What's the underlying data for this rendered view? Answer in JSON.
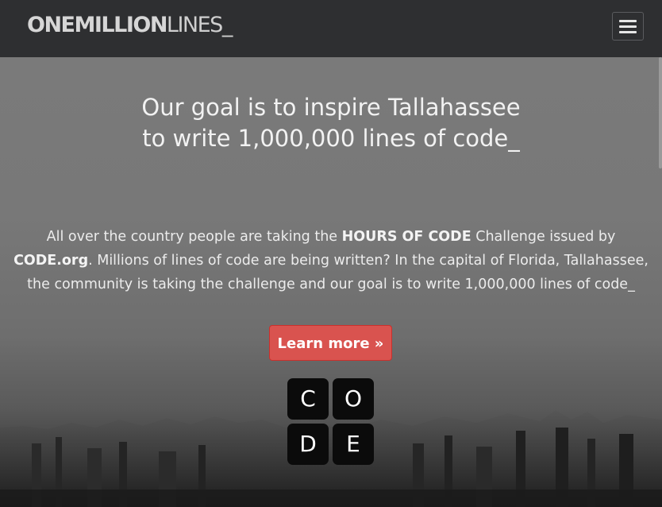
{
  "header": {
    "brand_bold": "ONEMILLION",
    "brand_light": "LINES_",
    "menu_icon": "hamburger-menu-icon"
  },
  "hero": {
    "headline": "Our goal is to inspire Tallahassee to write 1,000,000 lines of code_",
    "lead": {
      "part1": "All over the country people are taking the ",
      "bold1": "HOURS OF CODE",
      "part2": " Challenge issued by ",
      "bold2": "CODE.org",
      "part3": ". Millions of lines of code are being written? In the capital of Florida, Tallahassee, the community is taking the challenge and our goal is to write 1,000,000 lines of code_"
    },
    "cta_label": "Learn more »",
    "code_logo": {
      "tiles": [
        "C",
        "O",
        "D",
        "E"
      ]
    }
  },
  "colors": {
    "navbar": "#2e2f31",
    "button": "#d9534f",
    "tile": "#0b0b0b"
  }
}
